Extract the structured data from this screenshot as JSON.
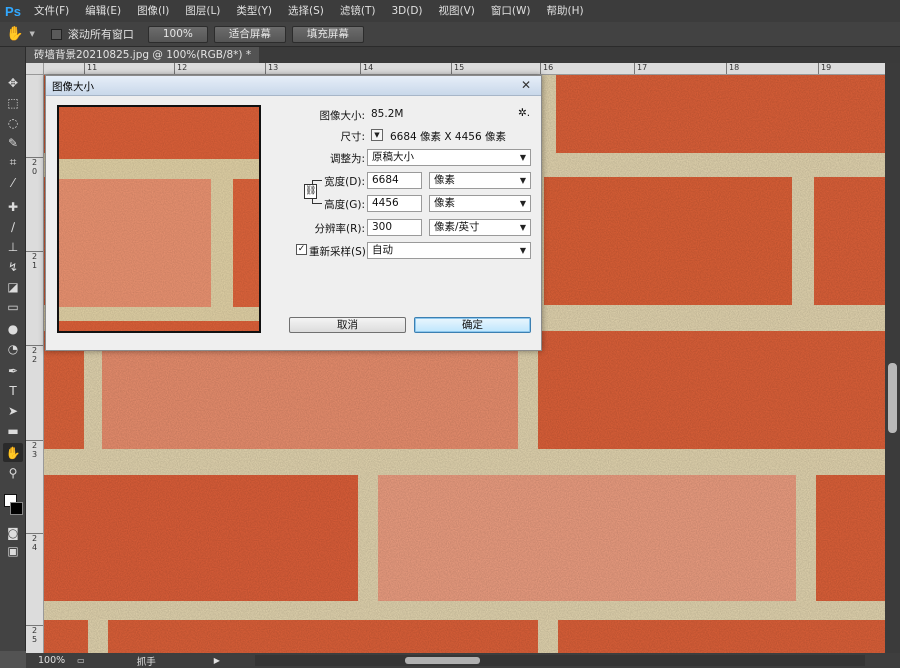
{
  "app": {
    "logo": "Ps"
  },
  "menu": [
    "文件(F)",
    "编辑(E)",
    "图像(I)",
    "图层(L)",
    "类型(Y)",
    "选择(S)",
    "滤镜(T)",
    "3D(D)",
    "视图(V)",
    "窗口(W)",
    "帮助(H)"
  ],
  "options": {
    "tool_icon": "hand-icon",
    "scroll_all_label": "滚动所有窗口",
    "zoom_100": "100%",
    "fit_screen": "适合屏幕",
    "fill_screen": "填充屏幕"
  },
  "document": {
    "tab_title": "砖墙背景20210825.jpg @ 100%(RGB/8*) *",
    "close": "×"
  },
  "rulers": {
    "h": [
      "11",
      "12",
      "13",
      "14",
      "15",
      "16",
      "17",
      "18",
      "19"
    ],
    "v": [
      "2",
      "0",
      "2",
      "1",
      "2",
      "2",
      "2",
      "3",
      "2",
      "4",
      "2",
      "5"
    ]
  },
  "tools": [
    "move-icon",
    "marquee-icon",
    "lasso-icon",
    "quick-select-icon",
    "crop-icon",
    "eyedropper-icon",
    "healing-icon",
    "brush-icon",
    "stamp-icon",
    "history-brush-icon",
    "eraser-icon",
    "gradient-icon",
    "blur-icon",
    "dodge-icon",
    "pen-icon",
    "type-icon",
    "path-select-icon",
    "shape-icon",
    "hand-icon",
    "zoom-icon"
  ],
  "dialog": {
    "title": "图像大小",
    "close": "✕",
    "image_size_label": "图像大小:",
    "image_size_value": "85.2M",
    "gear": "✲.",
    "dimensions_label": "尺寸:",
    "dimensions_value": "6684 像素  X  4456 像素",
    "fit_to_label": "调整为:",
    "fit_to_value": "原稿大小",
    "width_label": "宽度(D):",
    "width_value": "6684",
    "width_unit": "像素",
    "height_label": "高度(G):",
    "height_value": "4456",
    "height_unit": "像素",
    "resolution_label": "分辨率(R):",
    "resolution_value": "300",
    "resolution_unit": "像素/英寸",
    "resample_label": "重新采样(S):",
    "resample_value": "自动",
    "resample_checked": "✓",
    "cancel": "取消",
    "ok": "确定"
  },
  "status": {
    "zoom": "100%",
    "tool": "抓手",
    "arrow": "▶"
  },
  "colors": {
    "brick": "#e0623a",
    "brick_light": "#ef9b7a",
    "mortar": "#e8dcb8",
    "ps_blue": "#31a8ff"
  }
}
